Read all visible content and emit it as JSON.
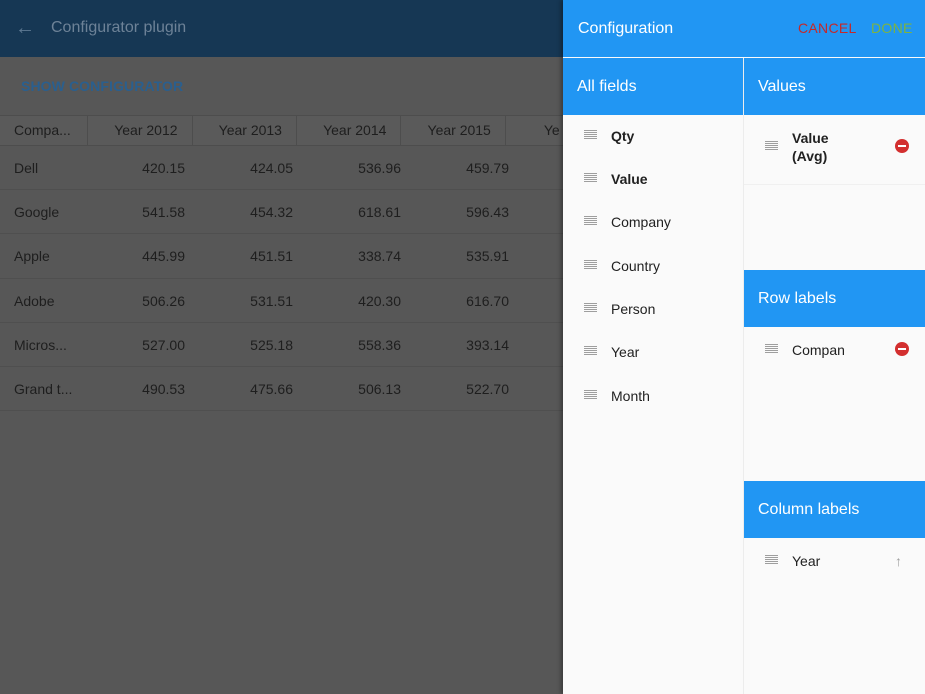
{
  "appbar": {
    "back_icon": "arrow-left-icon",
    "title": "Configurator plugin"
  },
  "main": {
    "show_configurator_label": "SHOW CONFIGURATOR",
    "grid": {
      "headers": [
        "Compa...",
        "Year 2012",
        "Year 2013",
        "Year 2014",
        "Year 2015",
        "Ye"
      ],
      "rows": [
        {
          "label": "Dell",
          "values": [
            "420.15",
            "424.05",
            "536.96",
            "459.79"
          ]
        },
        {
          "label": "Google",
          "values": [
            "541.58",
            "454.32",
            "618.61",
            "596.43"
          ]
        },
        {
          "label": "Apple",
          "values": [
            "445.99",
            "451.51",
            "338.74",
            "535.91"
          ]
        },
        {
          "label": "Adobe",
          "values": [
            "506.26",
            "531.51",
            "420.30",
            "616.70"
          ]
        },
        {
          "label": "Micros...",
          "values": [
            "527.00",
            "525.18",
            "558.36",
            "393.14"
          ]
        },
        {
          "label": "Grand t...",
          "values": [
            "490.53",
            "475.66",
            "506.13",
            "522.70"
          ]
        }
      ]
    }
  },
  "drawer": {
    "title": "Configuration",
    "cancel_label": "CANCEL",
    "done_label": "DONE",
    "colors": {
      "header": "#2196f3",
      "cancel": "#c62828",
      "done": "#7cb342",
      "remove": "#d32f2f"
    },
    "all_fields": {
      "title": "All fields",
      "items": [
        {
          "label": "Qty",
          "bold": true
        },
        {
          "label": "Value",
          "bold": true
        },
        {
          "label": "Company",
          "bold": false
        },
        {
          "label": "Country",
          "bold": false
        },
        {
          "label": "Person",
          "bold": false
        },
        {
          "label": "Year",
          "bold": false
        },
        {
          "label": "Month",
          "bold": false
        }
      ]
    },
    "values": {
      "title": "Values",
      "items": [
        {
          "label_line1": "Value",
          "label_line2": "(Avg)",
          "action_icon": "remove-circle-icon"
        }
      ]
    },
    "row_labels": {
      "title": "Row labels",
      "items": [
        {
          "label": "Compan",
          "action_icon": "remove-circle-icon"
        }
      ]
    },
    "column_labels": {
      "title": "Column labels",
      "items": [
        {
          "label": "Year",
          "action_icon": "arrow-up-icon",
          "action_glyph": "↑"
        }
      ]
    }
  }
}
